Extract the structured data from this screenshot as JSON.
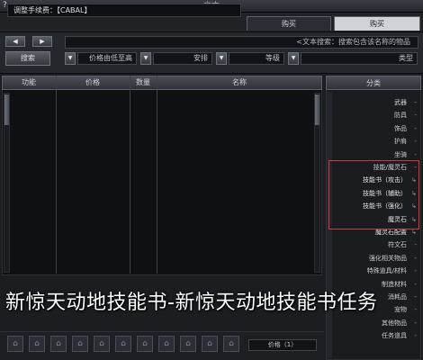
{
  "window": {
    "title": "文本",
    "close_label": "?"
  },
  "info": {
    "text": "调整手续费：【CABAL】"
  },
  "tabs": {
    "purchase": "购买",
    "sell": "购买"
  },
  "controls": {
    "prev_arrow": "◀",
    "next_arrow": "▶",
    "search_text": "<文本搜索：搜索包含该名称的物品",
    "search_button": "搜索",
    "filters": [
      "价格由低至高",
      "安排",
      "等级",
      "类型"
    ]
  },
  "table": {
    "columns": [
      "功能",
      "价格",
      "数量",
      "名称"
    ]
  },
  "category": {
    "header": "分类",
    "items": [
      {
        "label": "武器",
        "mark": "-"
      },
      {
        "label": "防具",
        "mark": "-"
      },
      {
        "label": "饰品",
        "mark": "-"
      },
      {
        "label": "护肩",
        "mark": "-"
      },
      {
        "label": "坐骑",
        "mark": "-"
      },
      {
        "label": "技能/魔灵石",
        "mark": "-"
      },
      {
        "label": "技能书（攻击）",
        "mark": "↳"
      },
      {
        "label": "技能书（辅助）",
        "mark": "↳"
      },
      {
        "label": "技能书（强化）",
        "mark": "↳"
      },
      {
        "label": "魔灵石",
        "mark": "↳"
      },
      {
        "label": "魔灵石配置",
        "mark": "↳"
      },
      {
        "label": "符文石",
        "mark": "-"
      },
      {
        "label": "强化相关物品",
        "mark": "-"
      },
      {
        "label": "特殊道具/材料",
        "mark": "-"
      },
      {
        "label": "制造材料",
        "mark": "-"
      },
      {
        "label": "消耗品",
        "mark": "-"
      },
      {
        "label": "宠物",
        "mark": "-"
      },
      {
        "label": "其他物品",
        "mark": "-"
      },
      {
        "label": "任务道具",
        "mark": "-"
      }
    ]
  },
  "bottom": {
    "slot_glyph": "⌂",
    "page_label": "价格（1）"
  },
  "watermark": {
    "caption": "新惊天动地技能书-新惊天动地技能书任务"
  }
}
